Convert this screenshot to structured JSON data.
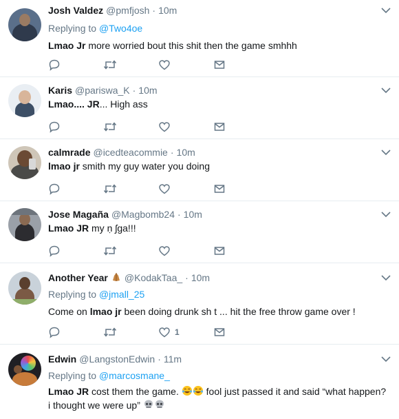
{
  "tweets": [
    {
      "name": "Josh Valdez",
      "handle": "@pmfjosh",
      "time": "10m",
      "replying_label": "Replying to",
      "replying_to": "@Two4oe",
      "bold": "Lmao Jr",
      "text": " more worried bout this shit then the game smhhh",
      "likes": ""
    },
    {
      "name": "Karis",
      "handle": "@pariswa_K",
      "time": "10m",
      "bold": "Lmao.... JR",
      "text": "... High ass",
      "likes": ""
    },
    {
      "name": "calmrade",
      "handle": "@icedteacommie",
      "time": "10m",
      "bold": "lmao jr",
      "text": " smith my guy water you doing",
      "likes": ""
    },
    {
      "name": "Jose Magaña",
      "handle": "@Magbomb24",
      "time": "10m",
      "bold": "Lmao JR",
      "text": " my ṇ ʃga!!!",
      "likes": ""
    },
    {
      "name": "Another Year",
      "handle": "@KodakTaa_",
      "time": "10m",
      "replying_label": "Replying to",
      "replying_to": "@jmall_25",
      "pre": "Come on ",
      "bold": "lmao jr",
      "text": " been doing drunk sh  t ... hit the free throw game over !",
      "likes": "1"
    },
    {
      "name": "Edwin",
      "handle": "@LangstonEdwin",
      "time": "11m",
      "replying_label": "Replying to",
      "replying_to": "@marcosmane_",
      "bold": "Lmao JR",
      "text": " cost them the game.",
      "text2": " fool just passed it and said “what happen? i thought we were up”",
      "likes": ""
    }
  ],
  "colors": {
    "link": "#1da1f2",
    "secondary": "#657786",
    "icon": "#657786",
    "divider": "#e6ecf0"
  },
  "icons": [
    "reply-icon",
    "retweet-icon",
    "like-icon",
    "dm-icon",
    "chevron-down-icon",
    "folded-hands-emoji",
    "tears-of-joy-emoji",
    "skull-emoji"
  ],
  "dot": "·"
}
